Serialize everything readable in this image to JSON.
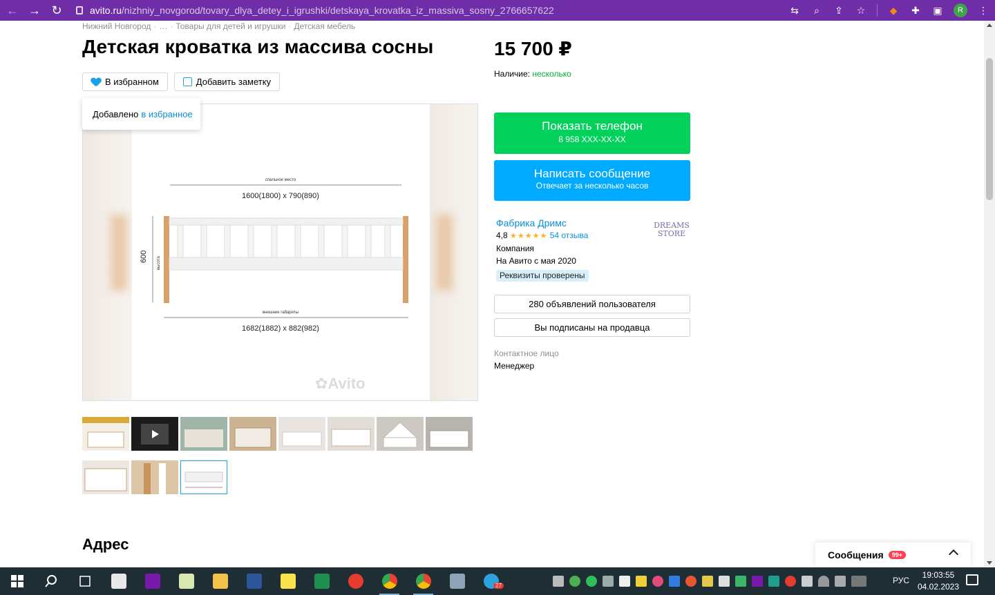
{
  "browser": {
    "url_host": "avito.ru",
    "url_path": "/nizhniy_novgorod/tovary_dlya_detey_i_igrushki/detskaya_krovatka_iz_massiva_sosny_2766657622",
    "profile_initial": "R"
  },
  "breadcrumb": [
    "Нижний Новгород",
    "…",
    "Товары для детей и игрушки",
    "Детская мебель"
  ],
  "listing": {
    "title": "Детская кроватка из массива сосны",
    "favorite_label": "В избранном",
    "add_note_label": "Добавить заметку",
    "tooltip_text": "Добавлено",
    "tooltip_link": "в избранное",
    "price": "15 700 ₽",
    "availability_label": "Наличие:",
    "availability_value": "несколько"
  },
  "image_annotations": {
    "sleep_place_label": "спальное место",
    "sleep_dims": "1600(1800) x 790(890)",
    "height_value": "600",
    "height_label": "высота",
    "outer_label": "внешние габариты",
    "outer_dims": "1682(1882) x 882(982)",
    "watermark": "Avito"
  },
  "thumbnails_count": 11,
  "thumbnails": [
    {
      "color": "#d9a93a"
    },
    {
      "color": "#1b1b1b"
    },
    {
      "color": "#9fb5a8"
    },
    {
      "color": "#cbb394"
    },
    {
      "color": "#e9e4e0"
    },
    {
      "color": "#e3ddd8"
    },
    {
      "color": "#cdc8c2"
    },
    {
      "color": "#b8b3ad"
    },
    {
      "color": "#ece7e1"
    },
    {
      "color": "#ddc6a8"
    },
    {
      "color": "#ffffff"
    }
  ],
  "actions": {
    "show_phone": "Показать телефон",
    "phone_masked": "8 958 XXX-XX-XX",
    "write_message": "Написать сообщение",
    "response_time": "Отвечает за несколько часов"
  },
  "seller": {
    "name": "Фабрика Дримс",
    "rating": "4,8",
    "stars": "★★★★★",
    "reviews": "54 отзыва",
    "type": "Компания",
    "since": "На Авито с мая 2020",
    "verified": "Реквизиты проверены",
    "logo_line1": "DREAMS",
    "logo_line2": "STORE",
    "ads_button": "280 объявлений пользователя",
    "subscribed_button": "Вы подписаны на продавца",
    "contact_label": "Контактное лицо",
    "contact_value": "Менеджер"
  },
  "section_address": "Адрес",
  "messages_widget": {
    "label": "Сообщения",
    "badge": "99+"
  },
  "taskbar": {
    "lang": "РУС",
    "time": "19:03:55",
    "date": "04.02.2023",
    "telegram_badge": "27"
  },
  "colors": {
    "chrome": "#6f2da8",
    "phone_button": "#02d15c",
    "message_button": "#00aaff",
    "link": "#0a8fd8",
    "available": "#02b232"
  }
}
